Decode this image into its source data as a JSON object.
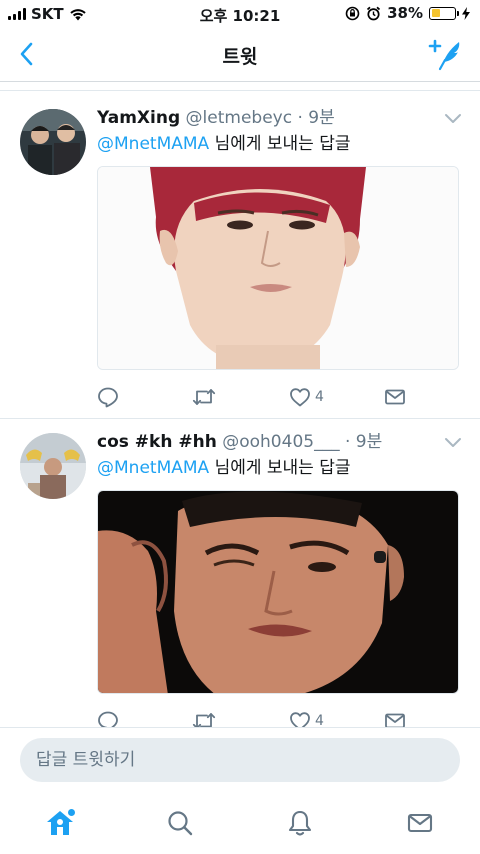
{
  "status_bar": {
    "carrier": "SKT",
    "time": "오후 10:21",
    "battery_percent": "38%",
    "battery_level": 0.38,
    "icons": [
      "signal-bars-icon",
      "wifi-icon",
      "orientation-lock-icon",
      "alarm-icon",
      "battery-icon",
      "charging-bolt-icon"
    ]
  },
  "nav": {
    "title": "트윗",
    "back_icon": "chevron-left-icon",
    "compose_icon": "compose-tweet-icon"
  },
  "tweets": [
    {
      "display_name": "YamXing",
      "handle": "@letmebeyc",
      "separator": "·",
      "time": "9분",
      "mention": "@MnetMAMA",
      "reply_suffix": " 님에게 보내는 답글",
      "likes": "4"
    },
    {
      "display_name": "cos #kh #hh",
      "handle": "@ooh0405___",
      "separator": "·",
      "time": "9분",
      "mention": "@MnetMAMA",
      "reply_suffix": " 님에게 보내는 답글",
      "likes": "4"
    }
  ],
  "composer": {
    "placeholder": "답글 트윗하기"
  },
  "tab_bar": {
    "tabs": [
      "home-icon",
      "search-icon",
      "notifications-icon",
      "messages-icon"
    ]
  },
  "colors": {
    "accent": "#1da1f2",
    "secondary_text": "#657786",
    "battery_fill": "#f4c430",
    "divider": "#e1e8ed"
  }
}
